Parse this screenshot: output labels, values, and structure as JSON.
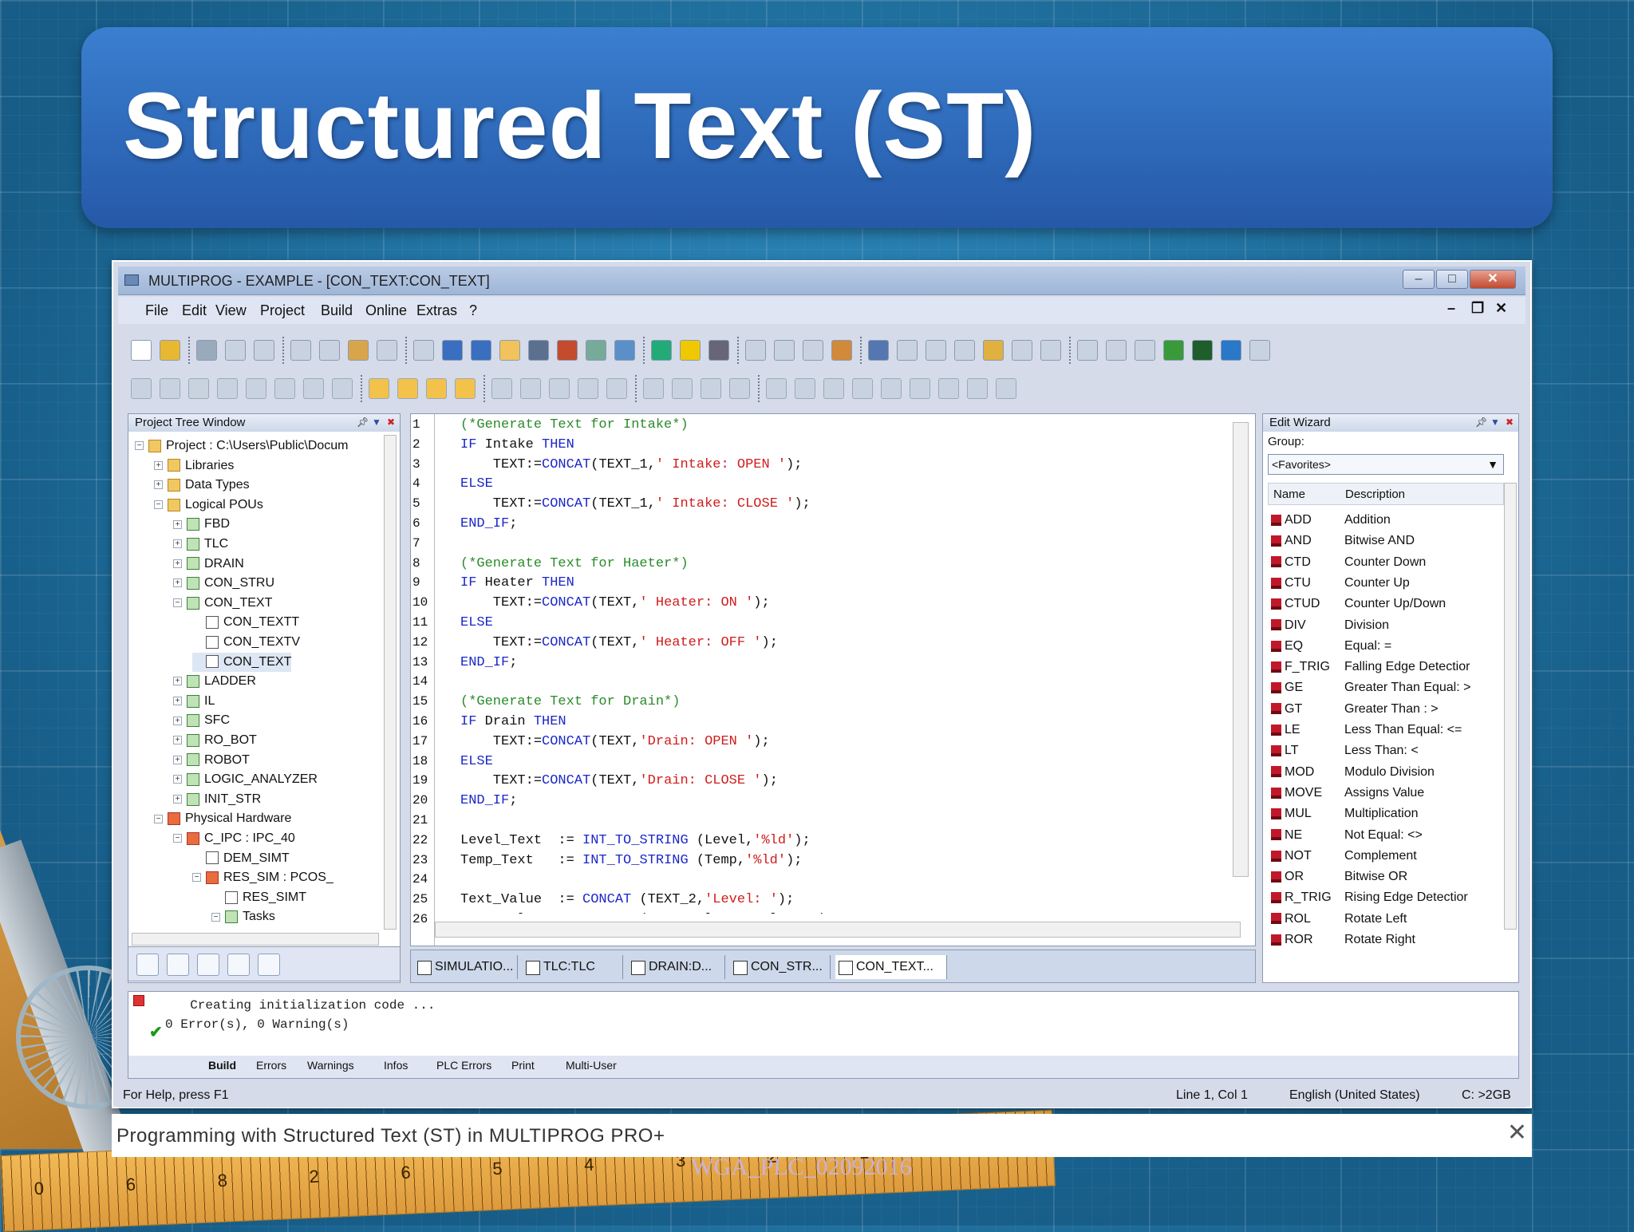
{
  "slide": {
    "title": "Structured Text (ST)",
    "caption": "Programming with Structured Text (ST) in MULTIPROG PRO+",
    "caption_close": "✕",
    "watermark": "WGA_PLC_02092016"
  },
  "ruler": {
    "numbers": [
      "0 ",
      "6",
      "8",
      "2",
      "6",
      "5",
      "4",
      "3",
      "2",
      "1",
      "0"
    ]
  },
  "window": {
    "title": "MULTIPROG - EXAMPLE - [CON_TEXT:CON_TEXT]",
    "min": "–",
    "max": "□",
    "close": "✕"
  },
  "menu": [
    "File",
    "Edit",
    "View",
    "Project",
    "Build",
    "Online",
    "Extras",
    "?"
  ],
  "mdi": {
    "min": "–",
    "restore": "❐",
    "close": "✕"
  },
  "project_tree": {
    "title": "Project Tree Window",
    "items": [
      {
        "label": "Project : C:\\Users\\Public\\Docum",
        "exp": "−",
        "ico": "folder",
        "level": 0
      },
      {
        "label": "Libraries",
        "exp": "+",
        "ico": "folder",
        "level": 1
      },
      {
        "label": "Data Types",
        "exp": "+",
        "ico": "folder",
        "level": 1
      },
      {
        "label": "Logical POUs",
        "exp": "−",
        "ico": "folder",
        "level": 1
      },
      {
        "label": "FBD",
        "exp": "+",
        "ico": "",
        "level": 2
      },
      {
        "label": "TLC",
        "exp": "+",
        "ico": "",
        "level": 2
      },
      {
        "label": "DRAIN",
        "exp": "+",
        "ico": "",
        "level": 2
      },
      {
        "label": "CON_STRU",
        "exp": "+",
        "ico": "",
        "level": 2
      },
      {
        "label": "CON_TEXT",
        "exp": "−",
        "ico": "",
        "level": 2
      },
      {
        "label": "CON_TEXTT",
        "exp": "",
        "ico": "doc",
        "level": 3
      },
      {
        "label": "CON_TEXTV",
        "exp": "",
        "ico": "doc",
        "level": 3
      },
      {
        "label": "CON_TEXT",
        "exp": "",
        "ico": "doc",
        "level": 3
      },
      {
        "label": "LADDER",
        "exp": "+",
        "ico": "",
        "level": 2
      },
      {
        "label": "IL",
        "exp": "+",
        "ico": "",
        "level": 2
      },
      {
        "label": "SFC",
        "exp": "+",
        "ico": "",
        "level": 2
      },
      {
        "label": "RO_BOT",
        "exp": "+",
        "ico": "",
        "level": 2
      },
      {
        "label": "ROBOT",
        "exp": "+",
        "ico": "",
        "level": 2
      },
      {
        "label": "LOGIC_ANALYZER",
        "exp": "+",
        "ico": "",
        "level": 2
      },
      {
        "label": "INIT_STR",
        "exp": "+",
        "ico": "",
        "level": 2
      },
      {
        "label": "Physical Hardware",
        "exp": "−",
        "ico": "red",
        "level": 1
      },
      {
        "label": "C_IPC : IPC_40",
        "exp": "−",
        "ico": "red",
        "level": 2
      },
      {
        "label": "DEM_SIMT",
        "exp": "",
        "ico": "doc",
        "level": 3
      },
      {
        "label": "RES_SIM : PCOS_",
        "exp": "−",
        "ico": "red",
        "level": 3
      },
      {
        "label": "RES_SIMT",
        "exp": "",
        "ico": "doc",
        "level": 4
      },
      {
        "label": "Tasks",
        "exp": "−",
        "ico": "",
        "level": 4
      }
    ]
  },
  "editor": {
    "lines": [
      [
        [
          "cm",
          "(*Generate Text for Intake*)"
        ]
      ],
      [
        [
          "kw",
          "IF "
        ],
        [
          "",
          "Intake "
        ],
        [
          "kw",
          "THEN"
        ]
      ],
      [
        [
          "",
          "    TEXT:="
        ],
        [
          "fn",
          "CONCAT"
        ],
        [
          "",
          "(TEXT_1,"
        ],
        [
          "st",
          "' Intake: OPEN '"
        ],
        [
          "",
          ");"
        ]
      ],
      [
        [
          "kw",
          "ELSE"
        ]
      ],
      [
        [
          "",
          "    TEXT:="
        ],
        [
          "fn",
          "CONCAT"
        ],
        [
          "",
          "(TEXT_1,"
        ],
        [
          "st",
          "' Intake: CLOSE '"
        ],
        [
          "",
          ");"
        ]
      ],
      [
        [
          "kw",
          "END_IF"
        ],
        [
          "",
          ";"
        ]
      ],
      [
        [
          "",
          ""
        ]
      ],
      [
        [
          "cm",
          "(*Generate Text for Haeter*)"
        ]
      ],
      [
        [
          "kw",
          "IF "
        ],
        [
          "",
          "Heater "
        ],
        [
          "kw",
          "THEN"
        ]
      ],
      [
        [
          "",
          "    TEXT:="
        ],
        [
          "fn",
          "CONCAT"
        ],
        [
          "",
          "(TEXT,"
        ],
        [
          "st",
          "' Heater: ON '"
        ],
        [
          "",
          ");"
        ]
      ],
      [
        [
          "kw",
          "ELSE"
        ]
      ],
      [
        [
          "",
          "    TEXT:="
        ],
        [
          "fn",
          "CONCAT"
        ],
        [
          "",
          "(TEXT,"
        ],
        [
          "st",
          "' Heater: OFF '"
        ],
        [
          "",
          ");"
        ]
      ],
      [
        [
          "kw",
          "END_IF"
        ],
        [
          "",
          ";"
        ]
      ],
      [
        [
          "",
          ""
        ]
      ],
      [
        [
          "cm",
          "(*Generate Text for Drain*)"
        ]
      ],
      [
        [
          "kw",
          "IF "
        ],
        [
          "",
          "Drain "
        ],
        [
          "kw",
          "THEN"
        ]
      ],
      [
        [
          "",
          "    TEXT:="
        ],
        [
          "fn",
          "CONCAT"
        ],
        [
          "",
          "(TEXT,"
        ],
        [
          "st",
          "'Drain: OPEN '"
        ],
        [
          "",
          ");"
        ]
      ],
      [
        [
          "kw",
          "ELSE"
        ]
      ],
      [
        [
          "",
          "    TEXT:="
        ],
        [
          "fn",
          "CONCAT"
        ],
        [
          "",
          "(TEXT,"
        ],
        [
          "st",
          "'Drain: CLOSE '"
        ],
        [
          "",
          ");"
        ]
      ],
      [
        [
          "kw",
          "END_IF"
        ],
        [
          "",
          ";"
        ]
      ],
      [
        [
          "",
          ""
        ]
      ],
      [
        [
          "",
          "Level_Text  := "
        ],
        [
          "fn",
          "INT_TO_STRING"
        ],
        [
          "",
          " (Level,"
        ],
        [
          "st",
          "'%ld'"
        ],
        [
          "",
          ");"
        ]
      ],
      [
        [
          "",
          "Temp_Text   := "
        ],
        [
          "fn",
          "INT_TO_STRING"
        ],
        [
          "",
          " (Temp,"
        ],
        [
          "st",
          "'%ld'"
        ],
        [
          "",
          ");"
        ]
      ],
      [
        [
          "",
          ""
        ]
      ],
      [
        [
          "",
          "Text_Value  := "
        ],
        [
          "fn",
          "CONCAT"
        ],
        [
          "",
          " (TEXT_2,"
        ],
        [
          "st",
          "'Level: '"
        ],
        [
          "",
          ");"
        ]
      ],
      [
        [
          "",
          "Text_Value  := "
        ],
        [
          "fn",
          "CONCAT"
        ],
        [
          "",
          " (Text_Value,Level_Text);"
        ]
      ]
    ]
  },
  "doc_tabs": [
    "SIMULATIO...",
    "TLC:TLC",
    "DRAIN:D...",
    "CON_STR...",
    "CON_TEXT..."
  ],
  "wizard": {
    "title": "Edit Wizard",
    "group_label": "Group:",
    "group_value": "<Favorites>",
    "col_name": "Name",
    "col_desc": "Description",
    "rows": [
      [
        "ADD",
        "Addition"
      ],
      [
        "AND",
        "Bitwise AND"
      ],
      [
        "CTD",
        "Counter Down"
      ],
      [
        "CTU",
        "Counter Up"
      ],
      [
        "CTUD",
        "Counter Up/Down"
      ],
      [
        "DIV",
        "Division"
      ],
      [
        "EQ",
        "Equal: ="
      ],
      [
        "F_TRIG",
        "Falling Edge Detectior"
      ],
      [
        "GE",
        "Greater Than Equal: >"
      ],
      [
        "GT",
        "Greater Than : >"
      ],
      [
        "LE",
        "Less Than Equal: <="
      ],
      [
        "LT",
        "Less Than: <"
      ],
      [
        "MOD",
        "Modulo Division"
      ],
      [
        "MOVE",
        "Assigns Value"
      ],
      [
        "MUL",
        "Multiplication"
      ],
      [
        "NE",
        "Not Equal: <>"
      ],
      [
        "NOT",
        "Complement"
      ],
      [
        "OR",
        "Bitwise OR"
      ],
      [
        "R_TRIG",
        "Rising Edge Detectior"
      ],
      [
        "ROL",
        "Rotate Left"
      ],
      [
        "ROR",
        "Rotate Right"
      ]
    ]
  },
  "output": {
    "line1": "  Creating initialization code ...",
    "line2": "0 Error(s), 0 Warning(s)",
    "tabs": [
      "Build",
      "Errors",
      "Warnings",
      "Infos",
      "PLC Errors",
      "Print",
      "Multi-User"
    ]
  },
  "status": {
    "help": "For Help, press F1",
    "pos": "Line 1, Col 1",
    "lang": "English (United States)",
    "mem": "C: >2GB"
  },
  "colors": {
    "banner": "#2f6cbf",
    "keyword": "#1b27c9",
    "comment": "#2a8a2a",
    "string": "#d01c1c"
  }
}
